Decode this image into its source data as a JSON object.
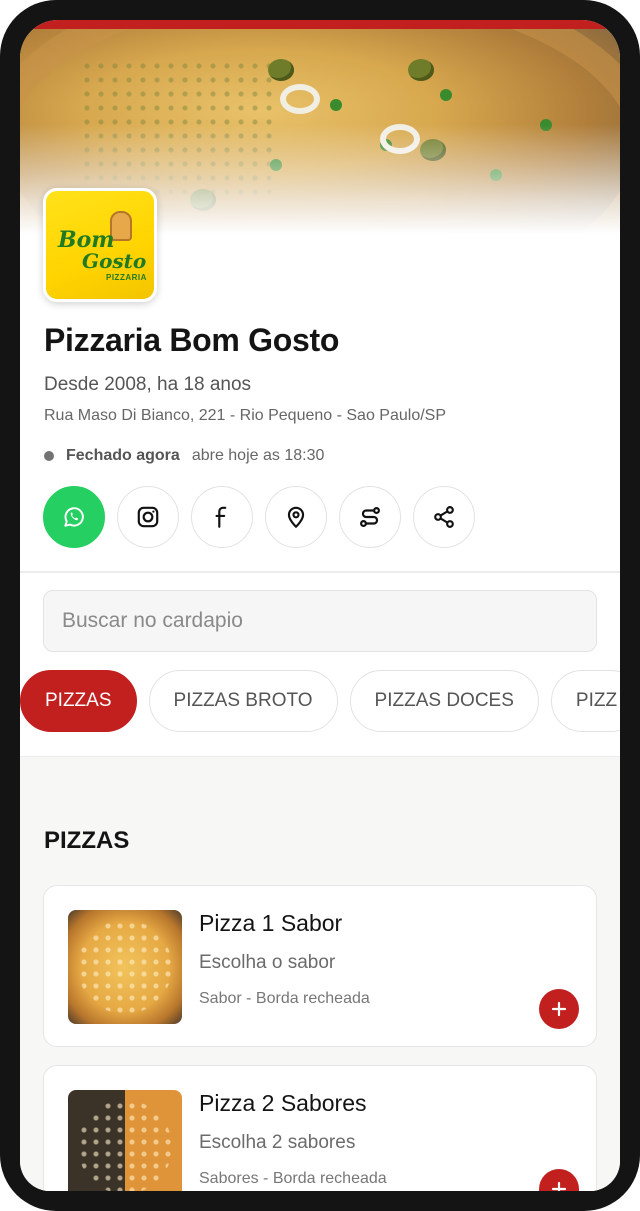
{
  "restaurant": {
    "name": "Pizzaria Bom Gosto",
    "since": "Desde 2008, ha 18 anos",
    "address": "Rua Maso Di Bianco, 221 - Rio Pequeno - Sao Paulo/SP",
    "status": {
      "label": "Fechado agora",
      "detail": "abre hoje as 18:30",
      "color": "#737373"
    },
    "logo_text": [
      "Bom",
      "Gosto",
      "PIZZARIA"
    ]
  },
  "actions": [
    {
      "icon": "whatsapp-icon"
    },
    {
      "icon": "instagram-icon"
    },
    {
      "icon": "facebook-icon"
    },
    {
      "icon": "location-pin-icon"
    },
    {
      "icon": "route-icon"
    },
    {
      "icon": "share-icon"
    }
  ],
  "search": {
    "placeholder": "Buscar no cardapio",
    "value": ""
  },
  "categories": [
    {
      "label": "PIZZAS",
      "active": true
    },
    {
      "label": "PIZZAS BROTO",
      "active": false
    },
    {
      "label": "PIZZAS DOCES",
      "active": false
    },
    {
      "label": "PIZZ",
      "active": false
    }
  ],
  "menu": {
    "section_title": "PIZZAS",
    "items": [
      {
        "title": "Pizza 1 Sabor",
        "subtitle": "Escolha o sabor",
        "description": "Sabor - Borda recheada"
      },
      {
        "title": "Pizza 2 Sabores",
        "subtitle": "Escolha 2 sabores",
        "description": "Sabores - Borda recheada"
      }
    ]
  },
  "colors": {
    "accent": "#c21f1f",
    "whatsapp": "#25cf61",
    "status_dot": "#737373"
  }
}
